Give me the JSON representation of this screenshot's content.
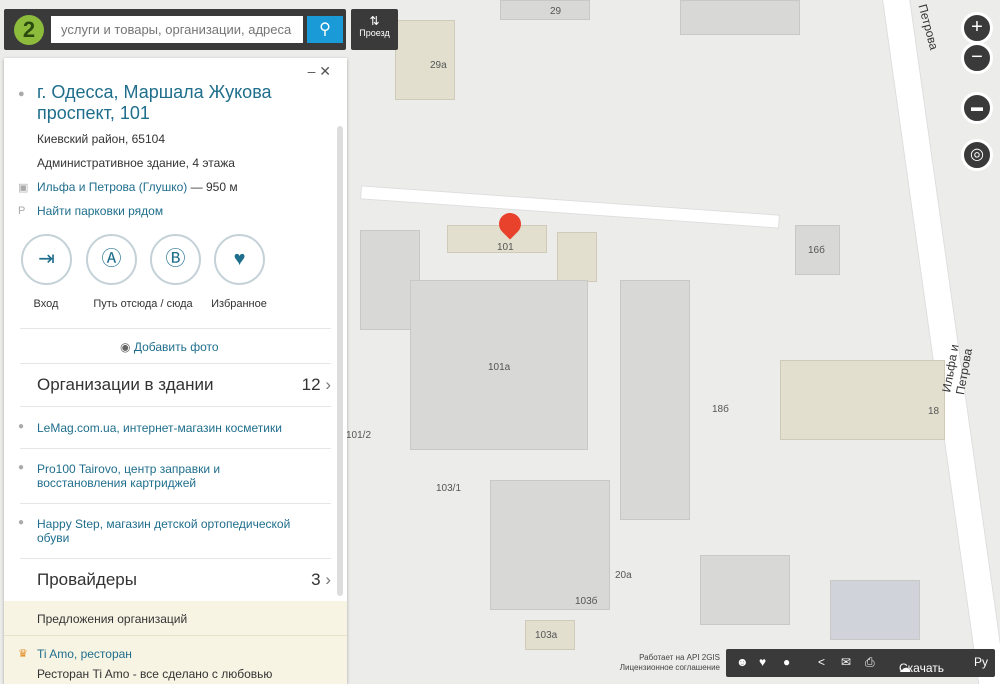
{
  "search": {
    "placeholder": "услуги и товары, организации, адреса",
    "logo": "2",
    "proezd_label": "Проезд"
  },
  "card": {
    "title": "г. Одесса, Маршала Жукова проспект, 101",
    "district": "Киевский район, 65104",
    "building": "Административное здание, 4 этажа",
    "transit_stop": "Ильфа и Петрова (Глушко)",
    "transit_distance": "— 950 м",
    "parking": "Найти парковки рядом",
    "actions": [
      {
        "label": "Вход",
        "icon": "entrance-icon"
      },
      {
        "label": "Путь отсюда / сюда",
        "icon": "route-icon"
      },
      {
        "label": "",
        "icon": "route-b-icon"
      },
      {
        "label": "Избранное",
        "icon": "heart-icon"
      }
    ],
    "add_photo": "Добавить фото",
    "orgs_title": "Организации в здании",
    "orgs_count": "12",
    "orgs": [
      "LeMag.com.ua, интернет-магазин косметики",
      "Pro100 Tairovo, центр заправки и восстановления картриджей",
      "Happy Step, магазин детской ортопедической обуви"
    ],
    "providers_title": "Провайдеры",
    "providers_count": "3",
    "offers_title": "Предложения организаций",
    "offer_name": "Ti Amo, ресторан",
    "offer_text": "Ресторан Ti Amo - все сделано с любовью"
  },
  "map": {
    "labels": [
      "29",
      "29а",
      "16б",
      "18б",
      "18",
      "101а",
      "101",
      "101/2",
      "103/1",
      "103б",
      "103а",
      "20а"
    ],
    "streets": [
      "Ильфа и Петрова",
      "Петрова"
    ],
    "credits": [
      "Работает на API 2GIS",
      "Лицензионное соглашение"
    ]
  },
  "bottom": {
    "download": "Скачать",
    "lang": "Ру"
  }
}
